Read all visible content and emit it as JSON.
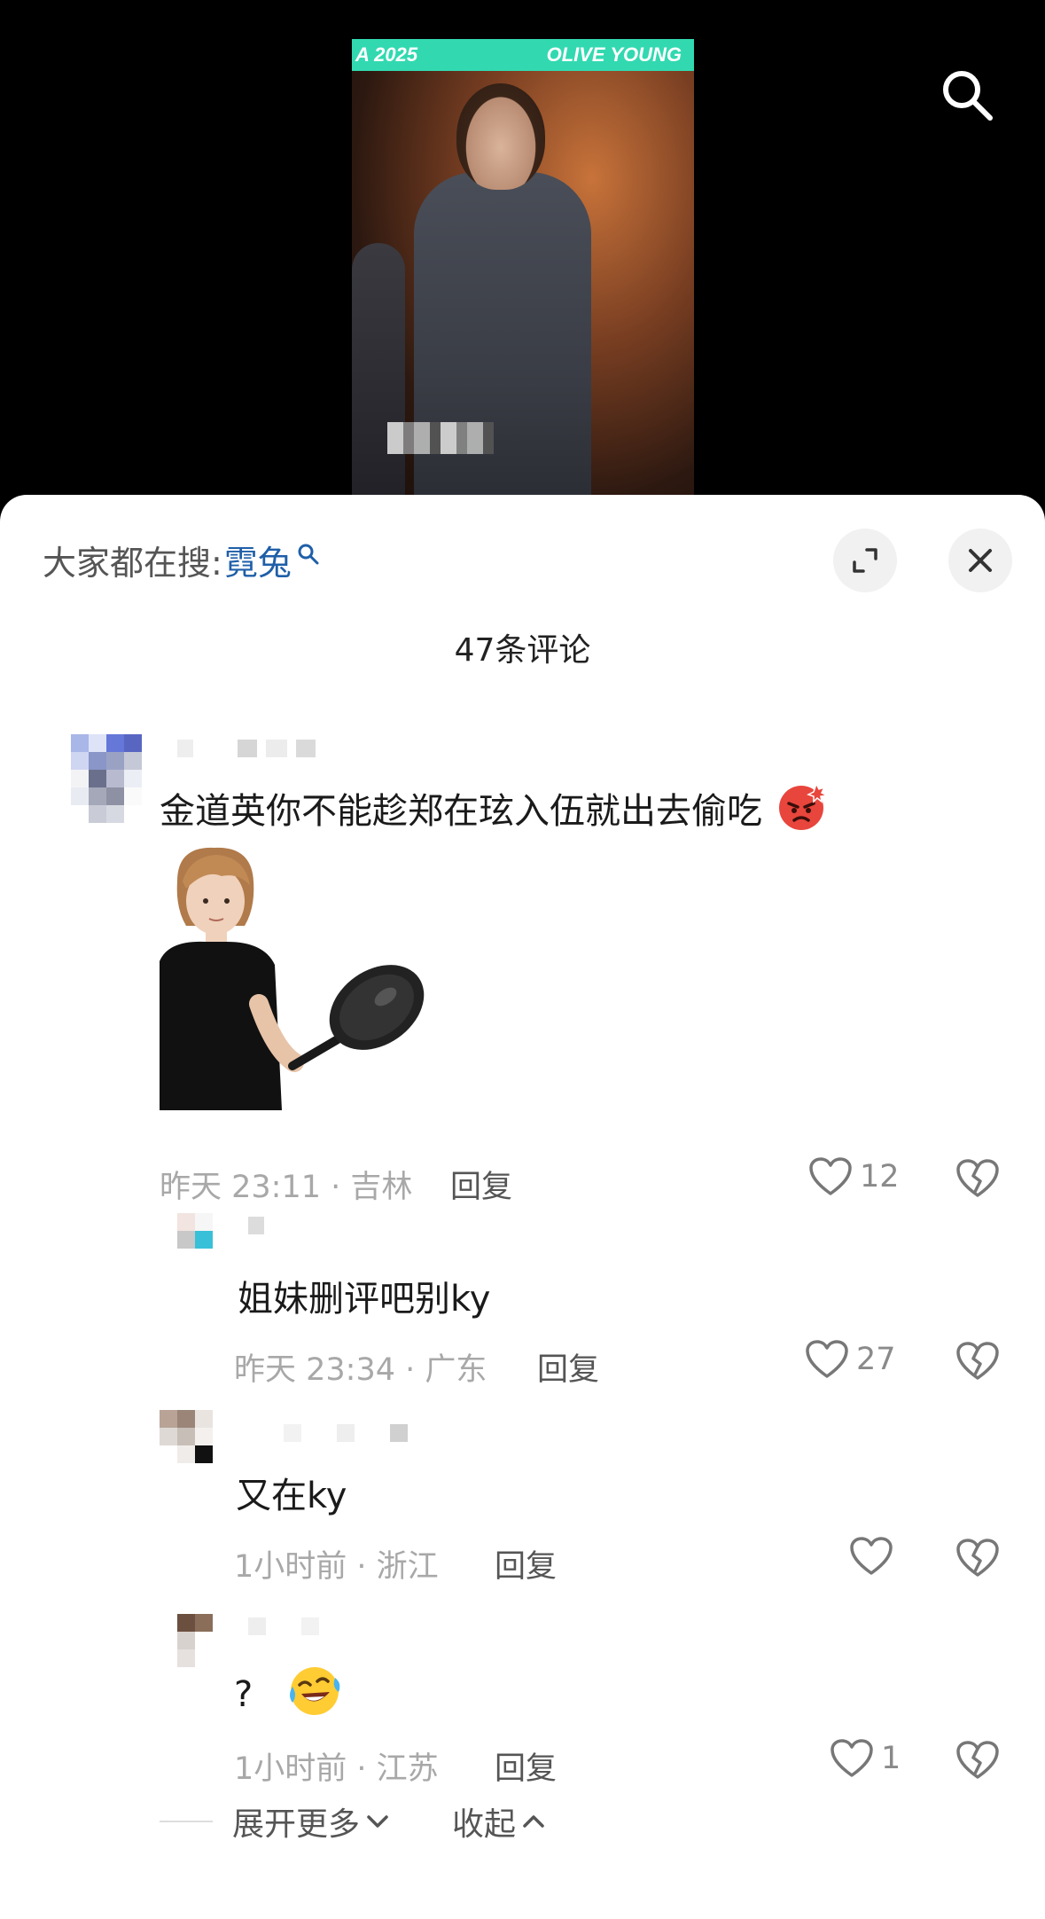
{
  "video": {
    "banner_left": "A 2025",
    "banner_right": "OLIVE YOUNG"
  },
  "sheet": {
    "hot_search_label": "大家都在搜:",
    "hot_search_term": "霓兔",
    "title": "47条评论"
  },
  "comments": [
    {
      "text": "金道英你不能趁郑在玹入伍就出去偷吃",
      "emoji": "angry-face-emoji",
      "meta": "昨天 23:11 · 吉林",
      "reply_label": "回复",
      "likes": "12",
      "has_sticker": true
    },
    {
      "text": "姐妹删评吧别ky",
      "meta": "昨天 23:34 · 广东",
      "reply_label": "回复",
      "likes": "27"
    },
    {
      "text": "又在ky",
      "meta": "1小时前 · 浙江",
      "reply_label": "回复",
      "likes": ""
    },
    {
      "text": "?",
      "emoji": "laughing-crying-emoji",
      "meta": "1小时前 · 江苏",
      "reply_label": "回复",
      "likes": "1"
    }
  ],
  "footer": {
    "expand_label": "展开更多",
    "collapse_label": "收起"
  },
  "colors": {
    "link": "#1f5fa8",
    "banner": "#32d9b0",
    "meta": "#a8a8a8"
  }
}
